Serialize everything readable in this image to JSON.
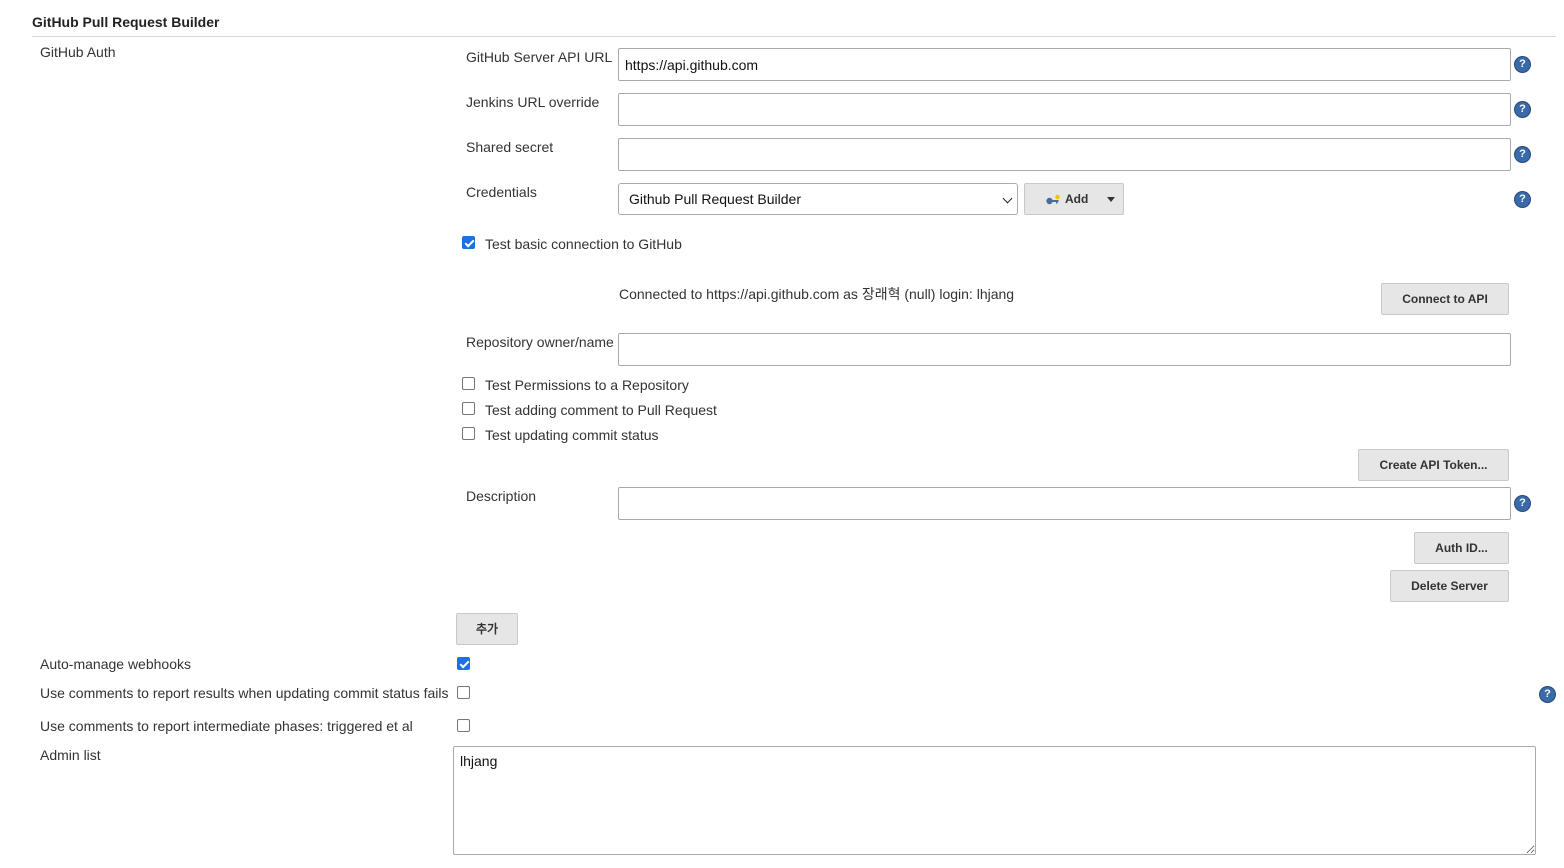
{
  "section": {
    "title": "GitHub Pull Request Builder"
  },
  "github_auth": {
    "label": "GitHub Auth",
    "server_api_url": {
      "label": "GitHub Server API URL",
      "value": "https://api.github.com"
    },
    "jenkins_url_override": {
      "label": "Jenkins URL override",
      "value": ""
    },
    "shared_secret": {
      "label": "Shared secret",
      "value": ""
    },
    "credentials": {
      "label": "Credentials",
      "selected": "Github Pull Request Builder",
      "add_label": "Add"
    },
    "test_basic_connection": {
      "label": "Test basic connection to GitHub",
      "checked": true
    },
    "connection_status": "Connected to https://api.github.com as 장래혁 (null) login: lhjang",
    "connect_button": "Connect to API",
    "repository": {
      "label": "Repository owner/name",
      "value": ""
    },
    "test_permissions": {
      "label": "Test Permissions to a Repository",
      "checked": false
    },
    "test_comment": {
      "label": "Test adding comment to Pull Request",
      "checked": false
    },
    "test_commit_status": {
      "label": "Test updating commit status",
      "checked": false
    },
    "create_token_button": "Create API Token...",
    "description": {
      "label": "Description",
      "value": ""
    },
    "auth_id_button": "Auth ID...",
    "delete_server_button": "Delete Server",
    "add_server_button": "추가"
  },
  "options": {
    "auto_manage_webhooks": {
      "label": "Auto-manage webhooks",
      "checked": true
    },
    "comments_on_status_fail": {
      "label": "Use comments to report results when updating commit status fails",
      "checked": false
    },
    "comments_intermediate": {
      "label": "Use comments to report intermediate phases: triggered et al",
      "checked": false
    },
    "admin_list": {
      "label": "Admin list",
      "value": "lhjang"
    }
  },
  "icons": {
    "help": "?"
  },
  "colors": {
    "help_icon": "#3b6aa8",
    "checkbox_checked": "#1e6fe0",
    "button_bg": "#e6e6e6"
  }
}
